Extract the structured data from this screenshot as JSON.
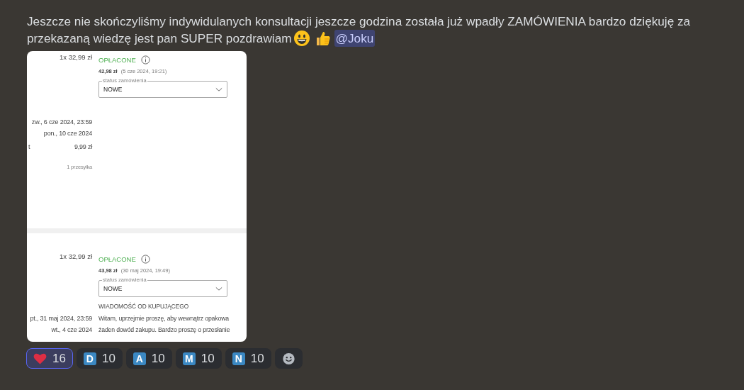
{
  "message": {
    "lines": [
      "Jeszcze nie skończyliśmy indywidulanych konsultacji jeszcze godzina została już wpadły ZAMÓWIENIA bardzo dziękuję za",
      "przekazaną wiedzę jest pan SUPER pozdrawiam"
    ],
    "mention": "@Joku"
  },
  "attachment": {
    "orders": [
      {
        "quantity_price": "1x 32,99 zł",
        "payment_status": "OPŁACONE",
        "total": "42,98 zł",
        "paid_at": "(5 cze 2024, 19:21)",
        "status_label": "status zamówienia",
        "status_value": "NOWE",
        "details": [
          {
            "value": "zw., 6 cze 2024, 23:59",
            "kind": "value"
          },
          {
            "value": "pon., 10 cze 2024",
            "kind": "value"
          },
          {
            "label": "t",
            "value": "9,99 zł",
            "kind": "value"
          },
          {
            "value": "1 przesyłka",
            "kind": "note"
          }
        ]
      },
      {
        "quantity_price": "1x 32,99 zł",
        "payment_status": "OPŁACONE",
        "total": "43,98 zł",
        "paid_at": "(30 maj 2024, 19:49)",
        "status_label": "status zamówienia",
        "status_value": "NOWE",
        "details": [
          {
            "value": "pt., 31 maj 2024, 23:59",
            "kind": "value"
          },
          {
            "value": "wt., 4 cze 2024",
            "kind": "value"
          }
        ],
        "buyer_message": {
          "heading": "WIADOMOŚĆ OD KUPUJĄCEGO",
          "lines": [
            "Witam, uprzejmie proszę, aby wewnątrz opakowa",
            "żaden dowód zakupu. Bardzo proszę o przesłanie"
          ]
        }
      }
    ]
  },
  "reactions": [
    {
      "kind": "heart",
      "count": "16",
      "selected": true
    },
    {
      "kind": "letter",
      "letter": "D",
      "count": "10",
      "selected": false
    },
    {
      "kind": "letter",
      "letter": "A",
      "count": "10",
      "selected": false
    },
    {
      "kind": "letter",
      "letter": "M",
      "count": "10",
      "selected": false
    },
    {
      "kind": "letter",
      "letter": "N",
      "count": "10",
      "selected": false
    },
    {
      "kind": "add",
      "selected": false
    }
  ]
}
